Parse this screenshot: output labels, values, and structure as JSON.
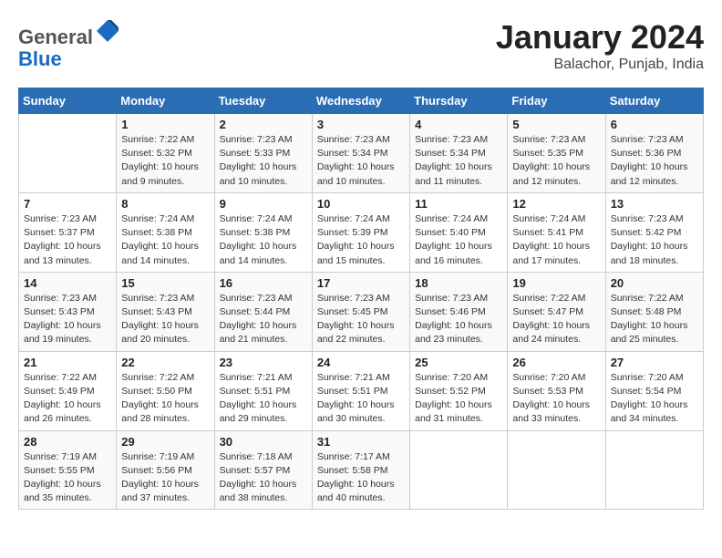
{
  "header": {
    "logo_general": "General",
    "logo_blue": "Blue",
    "title": "January 2024",
    "subtitle": "Balachor, Punjab, India"
  },
  "calendar": {
    "days_of_week": [
      "Sunday",
      "Monday",
      "Tuesday",
      "Wednesday",
      "Thursday",
      "Friday",
      "Saturday"
    ],
    "weeks": [
      [
        {
          "day": "",
          "info": ""
        },
        {
          "day": "1",
          "info": "Sunrise: 7:22 AM\nSunset: 5:32 PM\nDaylight: 10 hours\nand 9 minutes."
        },
        {
          "day": "2",
          "info": "Sunrise: 7:23 AM\nSunset: 5:33 PM\nDaylight: 10 hours\nand 10 minutes."
        },
        {
          "day": "3",
          "info": "Sunrise: 7:23 AM\nSunset: 5:34 PM\nDaylight: 10 hours\nand 10 minutes."
        },
        {
          "day": "4",
          "info": "Sunrise: 7:23 AM\nSunset: 5:34 PM\nDaylight: 10 hours\nand 11 minutes."
        },
        {
          "day": "5",
          "info": "Sunrise: 7:23 AM\nSunset: 5:35 PM\nDaylight: 10 hours\nand 12 minutes."
        },
        {
          "day": "6",
          "info": "Sunrise: 7:23 AM\nSunset: 5:36 PM\nDaylight: 10 hours\nand 12 minutes."
        }
      ],
      [
        {
          "day": "7",
          "info": "Sunrise: 7:23 AM\nSunset: 5:37 PM\nDaylight: 10 hours\nand 13 minutes."
        },
        {
          "day": "8",
          "info": "Sunrise: 7:24 AM\nSunset: 5:38 PM\nDaylight: 10 hours\nand 14 minutes."
        },
        {
          "day": "9",
          "info": "Sunrise: 7:24 AM\nSunset: 5:38 PM\nDaylight: 10 hours\nand 14 minutes."
        },
        {
          "day": "10",
          "info": "Sunrise: 7:24 AM\nSunset: 5:39 PM\nDaylight: 10 hours\nand 15 minutes."
        },
        {
          "day": "11",
          "info": "Sunrise: 7:24 AM\nSunset: 5:40 PM\nDaylight: 10 hours\nand 16 minutes."
        },
        {
          "day": "12",
          "info": "Sunrise: 7:24 AM\nSunset: 5:41 PM\nDaylight: 10 hours\nand 17 minutes."
        },
        {
          "day": "13",
          "info": "Sunrise: 7:23 AM\nSunset: 5:42 PM\nDaylight: 10 hours\nand 18 minutes."
        }
      ],
      [
        {
          "day": "14",
          "info": "Sunrise: 7:23 AM\nSunset: 5:43 PM\nDaylight: 10 hours\nand 19 minutes."
        },
        {
          "day": "15",
          "info": "Sunrise: 7:23 AM\nSunset: 5:43 PM\nDaylight: 10 hours\nand 20 minutes."
        },
        {
          "day": "16",
          "info": "Sunrise: 7:23 AM\nSunset: 5:44 PM\nDaylight: 10 hours\nand 21 minutes."
        },
        {
          "day": "17",
          "info": "Sunrise: 7:23 AM\nSunset: 5:45 PM\nDaylight: 10 hours\nand 22 minutes."
        },
        {
          "day": "18",
          "info": "Sunrise: 7:23 AM\nSunset: 5:46 PM\nDaylight: 10 hours\nand 23 minutes."
        },
        {
          "day": "19",
          "info": "Sunrise: 7:22 AM\nSunset: 5:47 PM\nDaylight: 10 hours\nand 24 minutes."
        },
        {
          "day": "20",
          "info": "Sunrise: 7:22 AM\nSunset: 5:48 PM\nDaylight: 10 hours\nand 25 minutes."
        }
      ],
      [
        {
          "day": "21",
          "info": "Sunrise: 7:22 AM\nSunset: 5:49 PM\nDaylight: 10 hours\nand 26 minutes."
        },
        {
          "day": "22",
          "info": "Sunrise: 7:22 AM\nSunset: 5:50 PM\nDaylight: 10 hours\nand 28 minutes."
        },
        {
          "day": "23",
          "info": "Sunrise: 7:21 AM\nSunset: 5:51 PM\nDaylight: 10 hours\nand 29 minutes."
        },
        {
          "day": "24",
          "info": "Sunrise: 7:21 AM\nSunset: 5:51 PM\nDaylight: 10 hours\nand 30 minutes."
        },
        {
          "day": "25",
          "info": "Sunrise: 7:20 AM\nSunset: 5:52 PM\nDaylight: 10 hours\nand 31 minutes."
        },
        {
          "day": "26",
          "info": "Sunrise: 7:20 AM\nSunset: 5:53 PM\nDaylight: 10 hours\nand 33 minutes."
        },
        {
          "day": "27",
          "info": "Sunrise: 7:20 AM\nSunset: 5:54 PM\nDaylight: 10 hours\nand 34 minutes."
        }
      ],
      [
        {
          "day": "28",
          "info": "Sunrise: 7:19 AM\nSunset: 5:55 PM\nDaylight: 10 hours\nand 35 minutes."
        },
        {
          "day": "29",
          "info": "Sunrise: 7:19 AM\nSunset: 5:56 PM\nDaylight: 10 hours\nand 37 minutes."
        },
        {
          "day": "30",
          "info": "Sunrise: 7:18 AM\nSunset: 5:57 PM\nDaylight: 10 hours\nand 38 minutes."
        },
        {
          "day": "31",
          "info": "Sunrise: 7:17 AM\nSunset: 5:58 PM\nDaylight: 10 hours\nand 40 minutes."
        },
        {
          "day": "",
          "info": ""
        },
        {
          "day": "",
          "info": ""
        },
        {
          "day": "",
          "info": ""
        }
      ]
    ]
  }
}
